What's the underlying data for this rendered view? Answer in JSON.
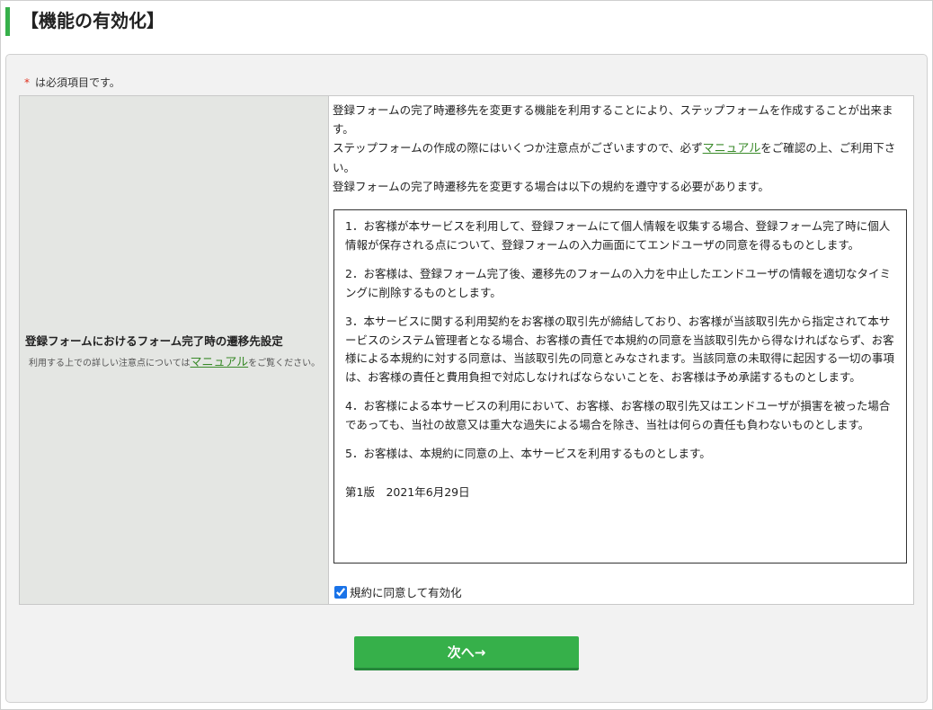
{
  "page": {
    "title": "【機能の有効化】"
  },
  "form": {
    "required_star": "*",
    "required_text": "は必須項目です。",
    "label": {
      "title": "登録フォームにおけるフォーム完了時の遷移先設定",
      "sub_before": "利用する上での詳しい注意点については",
      "sub_link": "マニュアル",
      "sub_after": "をご覧ください。"
    },
    "description": {
      "line1": "登録フォームの完了時遷移先を変更する機能を利用することにより、ステップフォームを作成することが出来ます。",
      "line2_before": "ステップフォームの作成の際にはいくつか注意点がございますので、必ず",
      "line2_link": "マニュアル",
      "line2_after": "をご確認の上、ご利用下さい。",
      "line3": "登録フォームの完了時遷移先を変更する場合は以下の規約を遵守する必要があります。"
    },
    "terms": [
      "1．お客様が本サービスを利用して、登録フォームにて個人情報を収集する場合、登録フォーム完了時に個人情報が保存される点について、登録フォームの入力画面にてエンドユーザの同意を得るものとします。",
      "2．お客様は、登録フォーム完了後、遷移先のフォームの入力を中止したエンドユーザの情報を適切なタイミングに削除するものとします。",
      "3．本サービスに関する利用契約をお客様の取引先が締結しており、お客様が当該取引先から指定されて本サービスのシステム管理者となる場合、お客様の責任で本規約の同意を当該取引先から得なければならず、お客様による本規約に対する同意は、当該取引先の同意とみなされます。当該同意の未取得に起因する一切の事項は、お客様の責任と費用負担で対応しなければならないことを、お客様は予め承諾するものとします。",
      "4．お客様による本サービスの利用において、お客様、お客様の取引先又はエンドユーザが損害を被った場合であっても、当社の故意又は重大な過失による場合を除き、当社は何らの責任も負わないものとします。",
      "5．お客様は、本規約に同意の上、本サービスを利用するものとします。"
    ],
    "version": "第1版　2021年6月29日",
    "agree_label": "規約に同意して有効化",
    "agree_checked": true
  },
  "actions": {
    "next_label": "次へ→"
  }
}
